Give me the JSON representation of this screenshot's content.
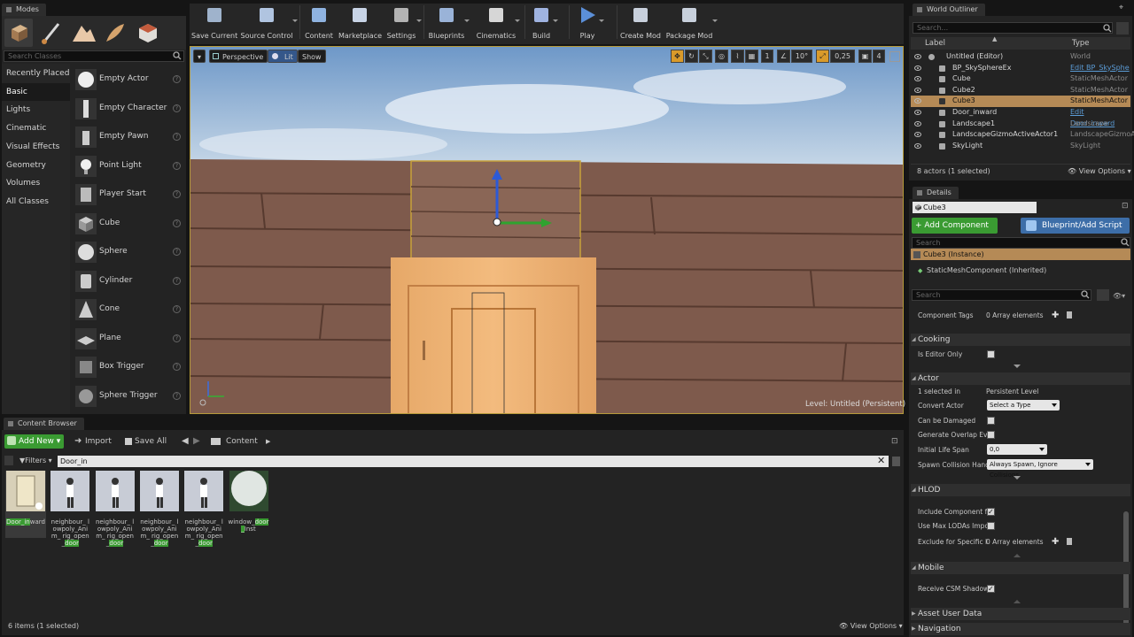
{
  "modes_tab": "Modes",
  "modes": {
    "search_placeholder": "Search Classes",
    "categories": [
      "Recently Placed",
      "Basic",
      "Lights",
      "Cinematic",
      "Visual Effects",
      "Geometry",
      "Volumes",
      "All Classes"
    ],
    "selected_category": "Basic",
    "items": [
      "Empty Actor",
      "Empty Character",
      "Empty Pawn",
      "Point Light",
      "Player Start",
      "Cube",
      "Sphere",
      "Cylinder",
      "Cone",
      "Plane",
      "Box Trigger",
      "Sphere Trigger"
    ],
    "help_glyph": "?"
  },
  "toolbar": {
    "buttons": [
      "Save Current",
      "Source Control",
      "Content",
      "Marketplace",
      "Settings",
      "Blueprints",
      "Cinematics",
      "Build",
      "Play",
      "Create Mod",
      "Package Mod"
    ]
  },
  "viewport": {
    "perspective": "Perspective",
    "lit": "Lit",
    "show": "Show",
    "snap_angle": "10°",
    "snap_scale": "0,25",
    "camera_speed": "4",
    "grid_value": "1",
    "level_label": "Level:",
    "level_name": "Untitled (Persistent)"
  },
  "outliner": {
    "tab": "World Outliner",
    "search_placeholder": "Search...",
    "col_label": "Label",
    "col_type": "Type",
    "rows": [
      {
        "name": "Untitled (Editor)",
        "type": "World",
        "indent": 0,
        "link": false,
        "selected": false
      },
      {
        "name": "BP_SkySphereEx",
        "type": "Edit BP_SkySphe",
        "indent": 1,
        "link": true,
        "selected": false
      },
      {
        "name": "Cube",
        "type": "StaticMeshActor",
        "indent": 1,
        "link": false,
        "selected": false
      },
      {
        "name": "Cube2",
        "type": "StaticMeshActor",
        "indent": 1,
        "link": false,
        "selected": false
      },
      {
        "name": "Cube3",
        "type": "StaticMeshActor",
        "indent": 1,
        "link": false,
        "selected": true
      },
      {
        "name": "Door_inward",
        "type": "Edit Door_inward",
        "indent": 1,
        "link": true,
        "selected": false
      },
      {
        "name": "Landscape1",
        "type": "Landscape",
        "indent": 1,
        "link": false,
        "selected": false
      },
      {
        "name": "LandscapeGizmoActiveActor1",
        "type": "LandscapeGizmoA",
        "indent": 1,
        "link": false,
        "selected": false
      },
      {
        "name": "SkyLight",
        "type": "SkyLight",
        "indent": 1,
        "link": false,
        "selected": false
      }
    ],
    "status": "8 actors (1 selected)",
    "view_options": "View Options"
  },
  "details": {
    "tab": "Details",
    "name_value": "Cube3",
    "add_component": "+ Add Component",
    "blueprint_script": "Blueprint/Add Script",
    "search_placeholder": "Search",
    "instance": "Cube3 (Instance)",
    "component": "StaticMeshComponent (Inherited)",
    "search2_placeholder": "Search",
    "component_tags_label": "Component Tags",
    "component_tags_value": "0 Array elements",
    "section_cooking": "Cooking",
    "is_editor_only": "Is Editor Only",
    "section_actor": "Actor",
    "selected_in_label": "1 selected in",
    "selected_in_value": "Persistent Level",
    "convert_actor_label": "Convert Actor",
    "convert_actor_value": "Select a Type",
    "can_be_damaged": "Can be Damaged",
    "generate_overlap": "Generate Overlap Ever",
    "initial_life_span_label": "Initial Life Span",
    "initial_life_span_value": "0,0",
    "spawn_collision_label": "Spawn Collision Handl",
    "spawn_collision_value": "Always Spawn, Ignore Collisions",
    "section_hlod": "HLOD",
    "include_component": "Include Component fo",
    "use_max_lod": "Use Max LODAs Impo",
    "exclude_label": "Exclude for Specific H",
    "exclude_value": "0 Array elements",
    "section_mobile": "Mobile",
    "receive_csm": "Receive CSM Shadow",
    "section_asset_user_data": "Asset User Data",
    "section_navigation": "Navigation"
  },
  "content_browser": {
    "tab": "Content Browser",
    "add_new": "Add New",
    "import": "Import",
    "save_all": "Save All",
    "path": "Content",
    "filters": "Filters",
    "search_value": "Door_in",
    "assets": [
      {
        "pre": "",
        "hl": "Door_in",
        "post": "ward"
      },
      {
        "pre": "neighbour_ lowpoly_Anim_ rig_open_",
        "hl": "door",
        "post": ""
      },
      {
        "pre": "neighbour_ lowpoly_Anim_ rig_open_",
        "hl": "door",
        "post": ""
      },
      {
        "pre": "neighbour_ lowpoly_Anim_ rig_open_",
        "hl": "door",
        "post": ""
      },
      {
        "pre": "neighbour_ lowpoly_Anim_ rig_open_",
        "hl": "door",
        "post": ""
      },
      {
        "pre": "window_",
        "hl": "door_",
        "post": "Inst"
      }
    ],
    "status": "6 items (1 selected)",
    "view_options": "View Options"
  }
}
